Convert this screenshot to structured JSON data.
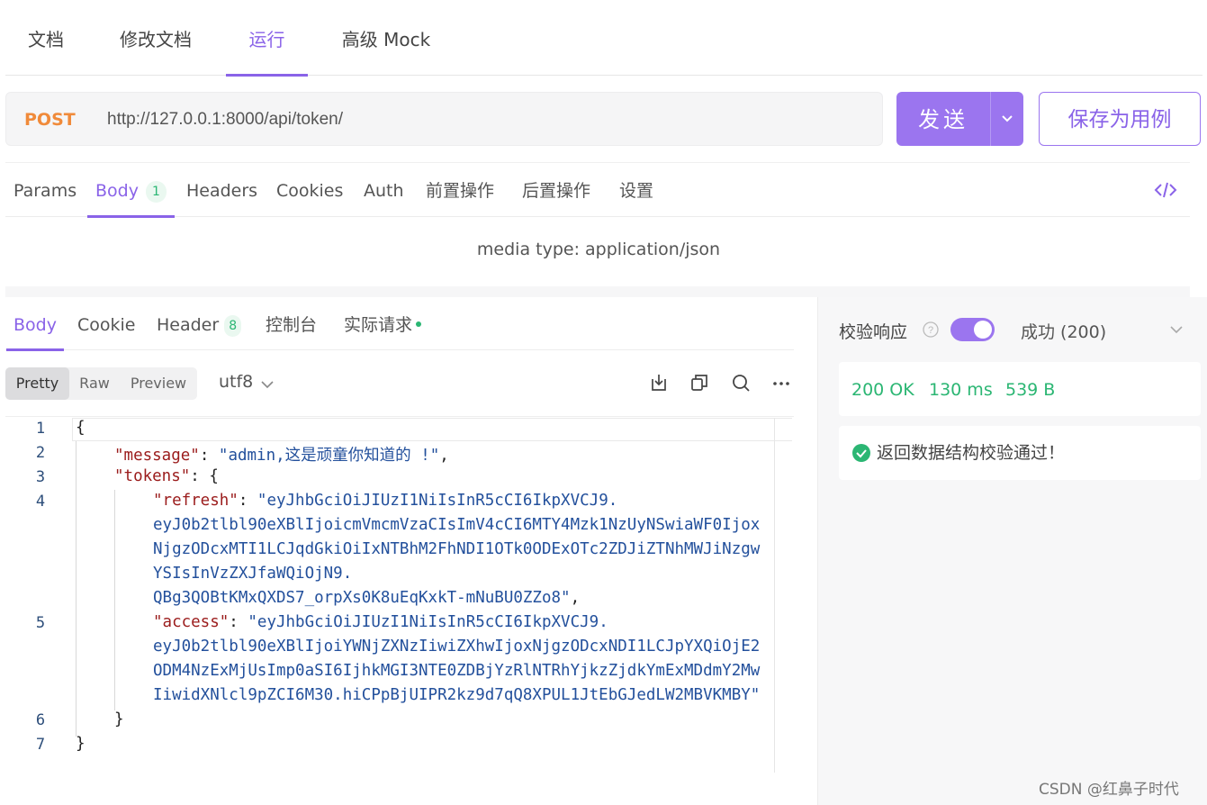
{
  "top_tabs": [
    {
      "label": "文档"
    },
    {
      "label": "修改文档"
    },
    {
      "label": "运行"
    },
    {
      "label": "高级 Mock"
    }
  ],
  "request": {
    "method": "POST",
    "url": "http://127.0.0.1:8000/api/token/",
    "send_label": "发送",
    "save_label": "保存为用例"
  },
  "request_tabs": [
    {
      "label": "Params"
    },
    {
      "label": "Body",
      "badge": "1"
    },
    {
      "label": "Headers"
    },
    {
      "label": "Cookies"
    },
    {
      "label": "Auth"
    },
    {
      "label": "前置操作"
    },
    {
      "label": "后置操作"
    },
    {
      "label": "设置"
    }
  ],
  "media_type": "media type: application/json",
  "response_tabs": [
    {
      "label": "Body"
    },
    {
      "label": "Cookie"
    },
    {
      "label": "Header",
      "badge": "8"
    },
    {
      "label": "控制台"
    },
    {
      "label": "实际请求"
    }
  ],
  "view_modes": [
    "Pretty",
    "Raw",
    "Preview"
  ],
  "encoding": "utf8",
  "code": {
    "line_numbers": [
      "1",
      "2",
      "3",
      "4",
      "5",
      "6",
      "7"
    ],
    "open_brace": "{",
    "message_key": "\"message\"",
    "message_value": "\"admin,这是顽童你知道的 !\"",
    "tokens_key": "\"tokens\"",
    "refresh_key": "\"refresh\"",
    "refresh_lines": [
      "\"eyJhbGciOiJIUzI1NiIsInR5cCI6IkpXVCJ9.",
      "eyJ0b2tlbl90eXBlIjoicmVmcmVzaCIsImV4cCI6MTY4Mzk1NzUyNSwiaWF0Ijox",
      "NjgzODcxMTI1LCJqdGkiOiIxNTBhM2FhNDI1OTk0ODExOTc2ZDJiZTNhMWJiNzgw",
      "YSIsInVzZXJfaWQiOjN9.",
      "QBg3QOBtKMxQXDS7_orpXs0K8uEqKxkT-mNuBU0ZZo8\""
    ],
    "access_key": "\"access\"",
    "access_lines": [
      "\"eyJhbGciOiJIUzI1NiIsInR5cCI6IkpXVCJ9.",
      "eyJ0b2tlbl90eXBlIjoiYWNjZXNzIiwiZXhwIjoxNjgzODcxNDI1LCJpYXQiOjE2",
      "ODM4NzExMjUsImp0aSI6IjhkMGI3NTE0ZDBjYzRlNTRhYjkzZjdkYmExMDdmY2Mw",
      "IiwidXNlcl9pZCI6M30.hiCPpBjUIPR2kz9d7qQ8XPUL1JtEbGJedLW2MBVKMBY\""
    ],
    "close_inner": "}",
    "close_outer": "}"
  },
  "validation": {
    "label": "校验响应",
    "enabled": true,
    "selected": "成功 (200)",
    "status": "200 OK",
    "time": "130 ms",
    "size": "539 B",
    "result": "返回数据结构校验通过！"
  },
  "watermark": "CSDN @红鼻子时代",
  "colors": {
    "accent": "#9b75ef",
    "method_post": "#f08a3a",
    "success": "#2bb673"
  }
}
